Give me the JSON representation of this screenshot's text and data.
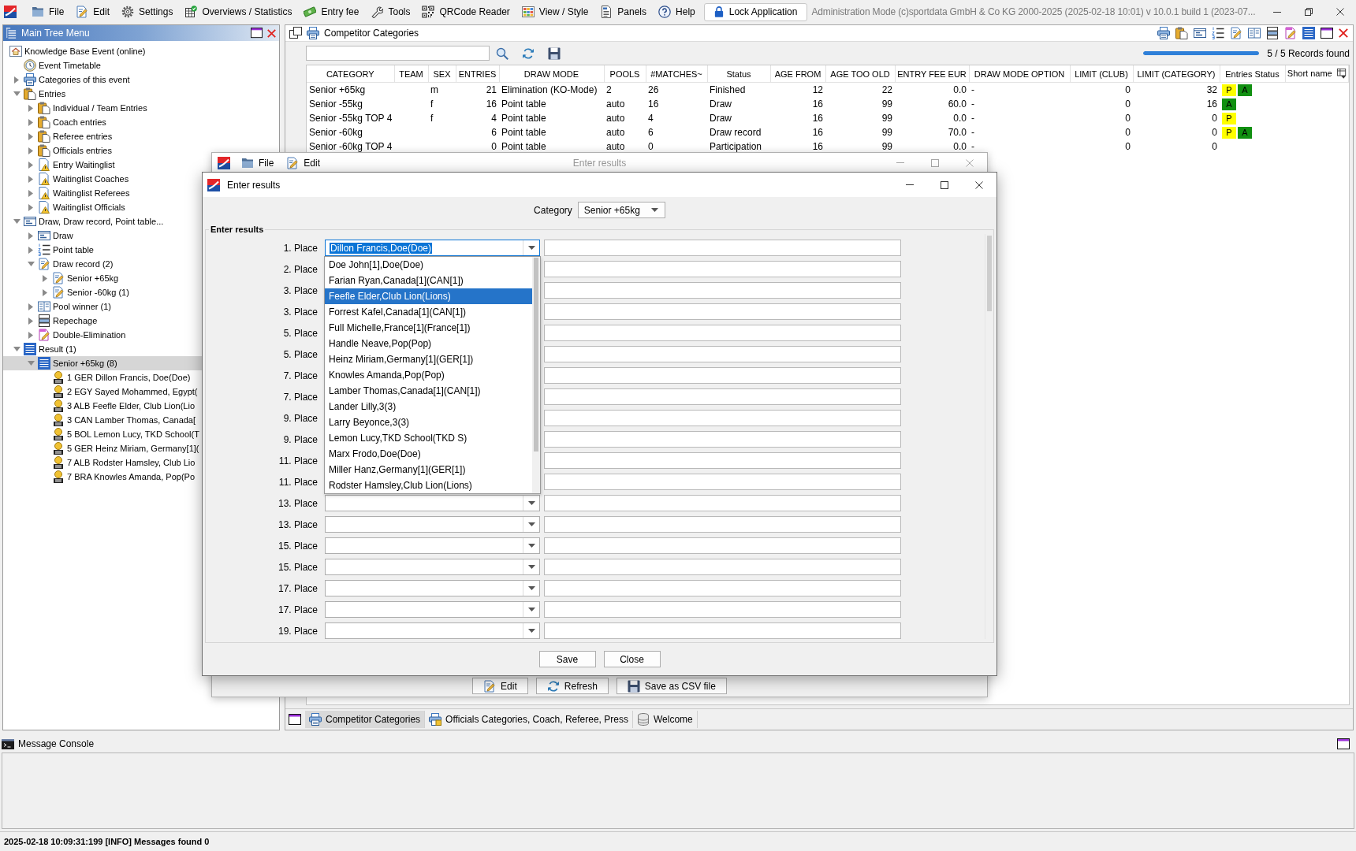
{
  "window": {
    "title": "Administration Mode (c)sportdata GmbH & Co KG 2000-2025 (2025-02-18 10:01) v 10.0.1 build 1 (2023-07..."
  },
  "menubar": {
    "items": [
      {
        "label": "File",
        "kind": "file"
      },
      {
        "label": "Edit",
        "kind": "edit"
      },
      {
        "label": "Settings",
        "kind": "settings"
      },
      {
        "label": "Overviews / Statistics",
        "kind": "statistics"
      },
      {
        "label": "Entry fee",
        "kind": "fee"
      },
      {
        "label": "Tools",
        "kind": "tools"
      },
      {
        "label": "QRCode Reader",
        "kind": "qrcode"
      },
      {
        "label": "View / Style",
        "kind": "view"
      },
      {
        "label": "Panels",
        "kind": "panels"
      },
      {
        "label": "Help",
        "kind": "help"
      }
    ],
    "lock_button": "Lock Application"
  },
  "tree": {
    "title": "Main Tree Menu",
    "items": [
      {
        "label": "Knowledge Base Event (online)",
        "kind": "event",
        "selected": false,
        "children": [
          {
            "label": "Event Timetable",
            "kind": "timetable",
            "selected": false
          },
          {
            "label": "Categories of this event",
            "kind": "categories",
            "selected": false,
            "expanded": false
          },
          {
            "label": "Entries",
            "kind": "entries",
            "selected": false,
            "expanded": true,
            "children": [
              {
                "label": "Individual / Team Entries",
                "kind": "entries",
                "selected": false,
                "expanded": false
              },
              {
                "label": "Coach entries",
                "kind": "entries",
                "selected": false,
                "expanded": false
              },
              {
                "label": "Referee entries",
                "kind": "entries",
                "selected": false,
                "expanded": false
              },
              {
                "label": "Officials entries",
                "kind": "entries",
                "selected": false,
                "expanded": false
              },
              {
                "label": "Entry Waitinglist",
                "kind": "waitinglist",
                "selected": false,
                "expanded": false
              },
              {
                "label": "Waitinglist Coaches",
                "kind": "waitinglist",
                "selected": false,
                "expanded": false
              },
              {
                "label": "Waitinglist Referees",
                "kind": "waitinglist",
                "selected": false,
                "expanded": false
              },
              {
                "label": "Waitinglist Officials",
                "kind": "waitinglist",
                "selected": false,
                "expanded": false
              }
            ]
          },
          {
            "label": "Draw, Draw record, Point table...",
            "kind": "draw",
            "selected": false,
            "expanded": true,
            "children": [
              {
                "label": "Draw",
                "kind": "draw",
                "selected": false,
                "expanded": false
              },
              {
                "label": "Point table",
                "kind": "pointtable",
                "selected": false,
                "expanded": false
              },
              {
                "label": "Draw record (2)",
                "kind": "drawrecord",
                "selected": false,
                "expanded": true,
                "children": [
                  {
                    "label": "Senior +65kg",
                    "kind": "drawrecord",
                    "selected": false,
                    "expanded": false
                  },
                  {
                    "label": "Senior -60kg (1)",
                    "kind": "drawrecord",
                    "selected": false,
                    "expanded": false
                  }
                ]
              },
              {
                "label": "Pool winner (1)",
                "kind": "poolwinner",
                "selected": false,
                "expanded": false
              },
              {
                "label": "Repechage",
                "kind": "repechage",
                "selected": false,
                "expanded": false
              },
              {
                "label": "Double-Elimination",
                "kind": "doubleelim",
                "selected": false,
                "expanded": false
              }
            ]
          },
          {
            "label": "Result (1)",
            "kind": "result",
            "selected": false,
            "expanded": true,
            "children": [
              {
                "label": "Senior +65kg (8)",
                "kind": "result",
                "selected": true,
                "expanded": true,
                "children": [
                  {
                    "label": "1 GER Dillon Francis, Doe(Doe)",
                    "kind": "medal",
                    "selected": false
                  },
                  {
                    "label": "2 EGY Sayed Mohammed, Egypt(",
                    "kind": "medal",
                    "selected": false
                  },
                  {
                    "label": "3 ALB Feefle Elder, Club Lion(Lio",
                    "kind": "medal",
                    "selected": false
                  },
                  {
                    "label": "3 CAN Lamber Thomas, Canada[",
                    "kind": "medal",
                    "selected": false
                  },
                  {
                    "label": "5 BOL Lemon Lucy, TKD School(T",
                    "kind": "medal",
                    "selected": false
                  },
                  {
                    "label": "5 GER Heinz Miriam, Germany[1](",
                    "kind": "medal",
                    "selected": false
                  },
                  {
                    "label": "7 ALB Rodster Hamsley, Club Lio",
                    "kind": "medal",
                    "selected": false
                  },
                  {
                    "label": "7 BRA Knowles Amanda, Pop(Po",
                    "kind": "medal",
                    "selected": false
                  }
                ]
              }
            ]
          }
        ]
      }
    ]
  },
  "categories": {
    "title": "Competitor Categories",
    "progress": {
      "level": 1
    },
    "records": "5 / 5 Records found",
    "table": {
      "columns": [
        "CATEGORY",
        "TEAM",
        "SEX",
        "ENTRIES",
        "DRAW MODE",
        "POOLS",
        "#MATCHES~",
        "Status",
        "AGE FROM",
        "AGE TOO OLD",
        "ENTRY FEE EUR",
        "DRAW MODE OPTION",
        "LIMIT (CLUB)",
        "LIMIT (CATEGORY)",
        "Entries Status",
        "Short name"
      ],
      "rows": [
        {
          "category": "Senior +65kg",
          "sex": "m",
          "entries": "21",
          "draw_mode": "Elimination (KO-Mode)",
          "pools": "2",
          "matches": "26",
          "status": "Finished",
          "age_from": "12",
          "age_too_old": "22",
          "entry_fee": "0.0",
          "draw_mode_option": "-",
          "limit_club": "0",
          "limit_category": "32",
          "entries_status": [
            {
              "label": "P",
              "color": "#ffff00"
            },
            {
              "label": "A",
              "color": "#119011"
            }
          ]
        },
        {
          "category": "Senior -55kg",
          "sex": "f",
          "entries": "16",
          "draw_mode": "Point table",
          "pools": "auto",
          "matches": "16",
          "status": "Draw",
          "age_from": "16",
          "age_too_old": "99",
          "entry_fee": "60.0",
          "draw_mode_option": "-",
          "limit_club": "0",
          "limit_category": "16",
          "entries_status": [
            {
              "label": "A",
              "color": "#119011"
            }
          ]
        },
        {
          "category": "Senior -55kg TOP 4",
          "sex": "f",
          "entries": "4",
          "draw_mode": "Point table",
          "pools": "auto",
          "matches": "4",
          "status": "Draw",
          "age_from": "16",
          "age_too_old": "99",
          "entry_fee": "0.0",
          "draw_mode_option": "-",
          "limit_club": "0",
          "limit_category": "0",
          "entries_status": [
            {
              "label": "P",
              "color": "#ffff00"
            }
          ]
        },
        {
          "category": "Senior -60kg",
          "entries": "6",
          "draw_mode": "Point table",
          "pools": "auto",
          "matches": "6",
          "status": "Draw record",
          "age_from": "16",
          "age_too_old": "99",
          "entry_fee": "70.0",
          "draw_mode_option": "-",
          "limit_club": "0",
          "limit_category": "0",
          "entries_status": [
            {
              "label": "P",
              "color": "#ffff00"
            },
            {
              "label": "A",
              "color": "#119011"
            }
          ]
        },
        {
          "category": "Senior -60kg TOP 4",
          "entries": "0",
          "draw_mode": "Point table",
          "pools": "auto",
          "matches": "0",
          "status": "Participation",
          "age_from": "16",
          "age_too_old": "99",
          "entry_fee": "0.0",
          "draw_mode_option": "-",
          "limit_club": "0",
          "limit_category": "0"
        }
      ]
    },
    "tabs": [
      {
        "label": "Competitor Categories",
        "kind": "competitors",
        "selected": true
      },
      {
        "label": "Officials Categories, Coach, Referee, Press",
        "kind": "officials",
        "selected": false
      },
      {
        "label": "Welcome",
        "kind": "welcome",
        "selected": false
      }
    ]
  },
  "back_window": {
    "title": "Enter results",
    "menu": [
      {
        "label": "File",
        "kind": "file"
      },
      {
        "label": "Edit",
        "kind": "edit"
      }
    ],
    "buttons": [
      {
        "label": "Edit",
        "kind": "edit"
      },
      {
        "label": "Refresh",
        "kind": "refresh"
      },
      {
        "label": "Save as CSV file",
        "kind": "save"
      }
    ]
  },
  "dialog": {
    "title": "Enter results",
    "category": {
      "label": "Category",
      "value": "Senior +65kg"
    },
    "section_title": "Enter results",
    "places": [
      {
        "label": "1. Place",
        "value": "Dillon Francis,Doe(Doe)",
        "expanded": true,
        "options": [
          {
            "label": "Doe John[1],Doe(Doe)",
            "selected": false
          },
          {
            "label": "Farian Ryan,Canada[1](CAN[1])",
            "selected": false
          },
          {
            "label": "Feefle Elder,Club Lion(Lions)",
            "selected": true
          },
          {
            "label": "Forrest Kafel,Canada[1](CAN[1])",
            "selected": false
          },
          {
            "label": "Full Michelle,France[1](France[1])",
            "selected": false
          },
          {
            "label": "Handle Neave,Pop(Pop)",
            "selected": false
          },
          {
            "label": "Heinz Miriam,Germany[1](GER[1])",
            "selected": false
          },
          {
            "label": "Knowles Amanda,Pop(Pop)",
            "selected": false
          },
          {
            "label": "Lamber Thomas,Canada[1](CAN[1])",
            "selected": false
          },
          {
            "label": "Lander Lilly,3(3)",
            "selected": false
          },
          {
            "label": "Larry Beyonce,3(3)",
            "selected": false
          },
          {
            "label": "Lemon Lucy,TKD School(TKD S)",
            "selected": false
          },
          {
            "label": "Marx Frodo,Doe(Doe)",
            "selected": false
          },
          {
            "label": "Miller Hanz,Germany[1](GER[1])",
            "selected": false
          },
          {
            "label": "Rodster Hamsley,Club Lion(Lions)",
            "selected": false
          }
        ]
      },
      {
        "label": "2. Place"
      },
      {
        "label": "3. Place"
      },
      {
        "label": "3. Place"
      },
      {
        "label": "5. Place"
      },
      {
        "label": "5. Place"
      },
      {
        "label": "7. Place"
      },
      {
        "label": "7. Place"
      },
      {
        "label": "9. Place"
      },
      {
        "label": "9. Place"
      },
      {
        "label": "11. Place"
      },
      {
        "label": "11. Place"
      },
      {
        "label": "13. Place",
        "expanded": false
      },
      {
        "label": "13. Place",
        "expanded": false
      },
      {
        "label": "15. Place",
        "expanded": false
      },
      {
        "label": "15. Place",
        "expanded": false
      },
      {
        "label": "17. Place",
        "expanded": false
      },
      {
        "label": "17. Place",
        "expanded": false
      },
      {
        "label": "19. Place",
        "expanded": false
      }
    ],
    "buttons": [
      "Save",
      "Close"
    ]
  },
  "console": {
    "title": "Message Console"
  },
  "status_bar": {
    "message": "2025-02-18 10:09:31:199 [INFO] Messages found 0"
  }
}
